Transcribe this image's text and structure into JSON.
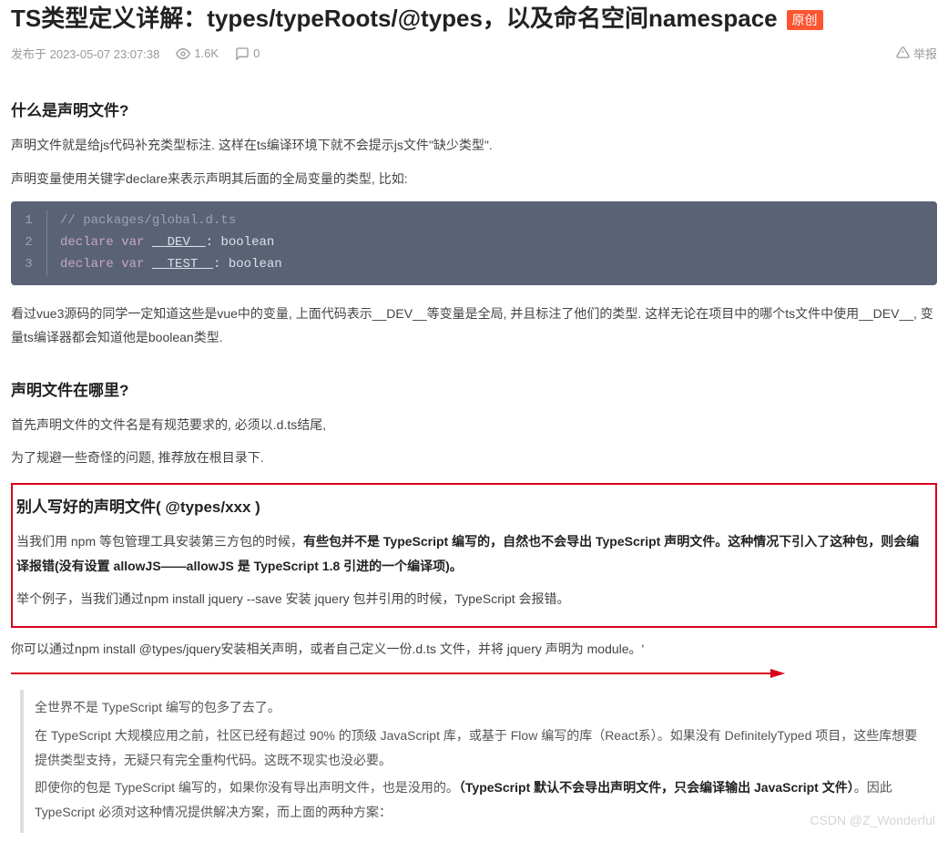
{
  "title": "TS类型定义详解：types/typeRoots/@types，以及命名空间namespace",
  "badge": "原创",
  "meta": {
    "publish": "发布于 2023-05-07 23:07:38",
    "views": "1.6K",
    "comments": "0",
    "report": "举报"
  },
  "section1": {
    "heading": "什么是声明文件?",
    "p1": "声明文件就是给js代码补充类型标注. 这样在ts编译环境下就不会提示js文件\"缺少类型\".",
    "p2": "声明变量使用关键字declare来表示声明其后面的全局变量的类型, 比如:"
  },
  "code": {
    "lines": [
      {
        "no": "1",
        "text": "// packages/global.d.ts",
        "class": "comment"
      },
      {
        "no": "2",
        "html": "declare var __DEV__: boolean"
      },
      {
        "no": "3",
        "html": "declare var __TEST__: boolean"
      }
    ]
  },
  "p_after_code": "看过vue3源码的同学一定知道这些是vue中的变量, 上面代码表示__DEV__等变量是全局, 并且标注了他们的类型. 这样无论在项目中的哪个ts文件中使用__DEV__, 变量ts编译器都会知道他是boolean类型.",
  "section2": {
    "heading": "声明文件在哪里?",
    "p1": "首先声明文件的文件名是有规范要求的, 必须以.d.ts结尾,",
    "p2": "为了规避一些奇怪的问题, 推荐放在根目录下."
  },
  "highlighted": {
    "heading": "别人写好的声明文件( @types/xxx )",
    "p1_a": "当我们用 npm 等包管理工具安装第三方包的时候，",
    "p1_b": "有些包并不是 TypeScript 编写的，自然也不会导出 TypeScript 声明文件。这种情况下引入了这种包，则会编译报错(没有设置 allowJS——allowJS 是 TypeScript 1.8 引进的一个编译项)。",
    "p2": "举个例子，当我们通过npm install jquery --save 安装 jquery 包并引用的时候，TypeScript 会报错。"
  },
  "p_below_box": "你可以通过npm install @types/jquery安装相关声明，或者自己定义一份.d.ts 文件，并将 jquery 声明为 module。'",
  "quote": {
    "l1": "全世界不是 TypeScript 编写的包多了去了。",
    "l2": "在 TypeScript 大规模应用之前，社区已经有超过 90% 的顶级 JavaScript 库，或基于 Flow 编写的库（React系）。如果没有 DefinitelyTyped 项目，这些库想要提供类型支持，无疑只有完全重构代码。这既不现实也没必要。",
    "l3_a": "即使你的包是 TypeScript 编写的，如果你没有导出声明文件，也是没用的。",
    "l3_b": "（TypeScript 默认不会导出声明文件，只会编译输出 JavaScript 文件）",
    "l3_c": "。因此 TypeScript 必须对这种情况提供解决方案，而上面的两种方案："
  },
  "watermark": "CSDN @Z_Wonderful"
}
